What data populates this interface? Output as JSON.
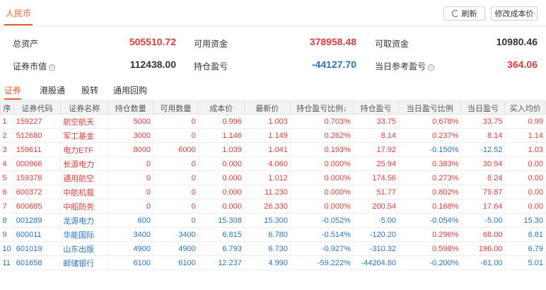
{
  "header": {
    "currency_tab": "人民币",
    "refresh_label": "刷新",
    "edit_cost_label": "修改成本价"
  },
  "summary": {
    "total_assets_label": "总资产",
    "total_assets": "505510.72",
    "available_funds_label": "可用资金",
    "available_funds": "378958.48",
    "withdrawable_label": "可取资金",
    "withdrawable": "10980.46",
    "market_value_label": "证券市值",
    "market_value": "112438.00",
    "position_pl_label": "持仓盈亏",
    "position_pl": "-44127.70",
    "daily_ref_pl_label": "当日参考盈亏",
    "daily_ref_pl": "364.06"
  },
  "colors": {
    "accent": "#e8612c",
    "up": "#e03a3a",
    "down": "#2773c7"
  },
  "tabs": [
    "证券",
    "港股通",
    "股转",
    "通用回购"
  ],
  "table": {
    "headers": [
      "序",
      "证券代码",
      "证券名称",
      "持仓数量",
      "可用数量",
      "成本价",
      "最新价",
      "持仓盈亏比例↓",
      "持仓盈亏",
      "当日盈亏比例",
      "当日盈亏",
      "买入均价"
    ],
    "rows": [
      {
        "n": "1",
        "code": "159227",
        "name": "航空航天",
        "qty": "5000",
        "avail": "0",
        "cost": "0.996",
        "last": "1.003",
        "plpct": "0.703%",
        "pl": "33.75",
        "dpct": "0.678%",
        "dpl": "33.75",
        "avg": "0.99"
      },
      {
        "n": "2",
        "code": "512680",
        "name": "军工基金",
        "qty": "3000",
        "avail": "0",
        "cost": "1.146",
        "last": "1.149",
        "plpct": "0.262%",
        "pl": "8.14",
        "dpct": "0.237%",
        "dpl": "8.14",
        "avg": "1.14"
      },
      {
        "n": "3",
        "code": "159611",
        "name": "电力ETF",
        "qty": "8000",
        "avail": "6000",
        "cost": "1.039",
        "last": "1.041",
        "plpct": "0.193%",
        "pl": "17.92",
        "dpct": "-0.150%",
        "dpl": "-12.52",
        "avg": "1.03"
      },
      {
        "n": "4",
        "code": "000966",
        "name": "长源电力",
        "qty": "0",
        "avail": "0",
        "cost": "0.000",
        "last": "4.060",
        "plpct": "0.000%",
        "pl": "25.94",
        "dpct": "0.383%",
        "dpl": "30.94",
        "avg": "0.00"
      },
      {
        "n": "5",
        "code": "159378",
        "name": "通用航空",
        "qty": "0",
        "avail": "0",
        "cost": "0.000",
        "last": "1.012",
        "plpct": "0.000%",
        "pl": "174.56",
        "dpct": "0.273%",
        "dpl": "8.24",
        "avg": "0.00"
      },
      {
        "n": "6",
        "code": "600372",
        "name": "中航机载",
        "qty": "0",
        "avail": "0",
        "cost": "0.000",
        "last": "11.230",
        "plpct": "0.000%",
        "pl": "51.77",
        "dpct": "0.802%",
        "dpl": "79.87",
        "avg": "0.00"
      },
      {
        "n": "7",
        "code": "600685",
        "name": "中船防务",
        "qty": "0",
        "avail": "0",
        "cost": "0.000",
        "last": "26.330",
        "plpct": "0.000%",
        "pl": "200.54",
        "dpct": "0.168%",
        "dpl": "17.64",
        "avg": "0.00"
      },
      {
        "n": "8",
        "code": "001289",
        "name": "龙源电力",
        "qty": "600",
        "avail": "0",
        "cost": "15.308",
        "last": "15.300",
        "plpct": "-0.052%",
        "pl": "-5.00",
        "dpct": "-0.054%",
        "dpl": "-5.00",
        "avg": "15.30"
      },
      {
        "n": "9",
        "code": "600011",
        "name": "华能国际",
        "qty": "3400",
        "avail": "3400",
        "cost": "6.815",
        "last": "6.780",
        "plpct": "-0.514%",
        "pl": "-120.20",
        "dpct": "0.296%",
        "dpl": "68.00",
        "avg": "6.81"
      },
      {
        "n": "10",
        "code": "601019",
        "name": "山东出版",
        "qty": "4900",
        "avail": "4900",
        "cost": "6.793",
        "last": "6.730",
        "plpct": "-0.927%",
        "pl": "-310.32",
        "dpct": "0.598%",
        "dpl": "196.00",
        "avg": "6.79"
      },
      {
        "n": "11",
        "code": "601658",
        "name": "邮储银行",
        "qty": "6100",
        "avail": "6100",
        "cost": "12.237",
        "last": "4.990",
        "plpct": "-59.222%",
        "pl": "-44204.80",
        "dpct": "-0.200%",
        "dpl": "-61.00",
        "avg": "5.01"
      }
    ]
  }
}
